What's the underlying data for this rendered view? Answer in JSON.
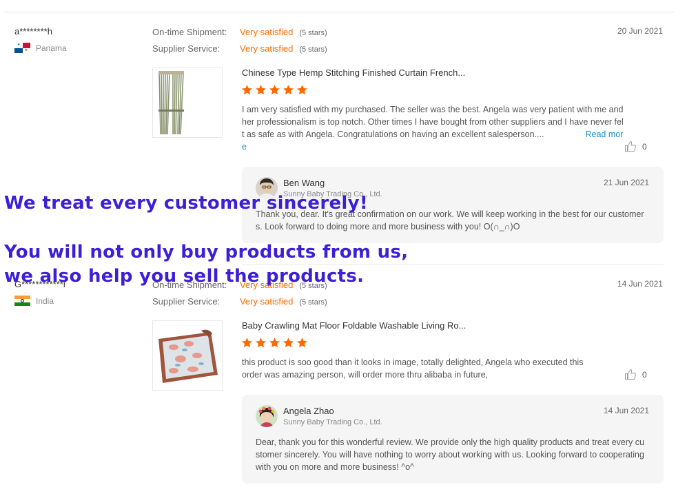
{
  "colors": {
    "accent": "#ff6a00",
    "link": "#1a8ed1",
    "overlay_text": "#3d1fd6",
    "reply_bg": "#f5f5f5"
  },
  "reviews": [
    {
      "buyer": "a********h",
      "country": "Panama",
      "flag_icon": "panama-flag-icon",
      "ontime_label": "On-time Shipment:",
      "ontime_value": "Very satisfied",
      "ontime_stars": "(5 stars)",
      "service_label": "Supplier Service:",
      "service_value": "Very satisfied",
      "service_stars": "(5 stars)",
      "date": "20 Jun 2021",
      "product_title": "Chinese Type Hemp Stitching Finished Curtain French...",
      "rating": 5,
      "text": "I am very satisfied with my purchased.  The seller was the best. Angela was very patient with me and her professionalism is top notch.  Other times I have bought from other suppliers and I have never felt as safe as with Angela. Congratulations on having an excellent salesperson....",
      "read_more": "Read more",
      "helpful_count": "0",
      "reply": {
        "name": "Ben Wang",
        "company": "Sunny Baby Trading Co., Ltd.",
        "date": "21 Jun 2021",
        "text": "Thank you, dear. It's great confirmation on our work. We will keep working in the best for our customers. Look forward to doing more and more business with you! O(∩_∩)O"
      }
    },
    {
      "buyer": "G************l",
      "country": "India",
      "flag_icon": "india-flag-icon",
      "ontime_label": "On-time Shipment:",
      "ontime_value": "Very satisfied",
      "ontime_stars": "(5 stars)",
      "service_label": "Supplier Service:",
      "service_value": "Very satisfied",
      "service_stars": "(5 stars)",
      "date": "14 Jun 2021",
      "product_title": "Baby Crawling Mat Floor Foldable Washable Living Ro...",
      "rating": 5,
      "text": "this product is soo good than it looks in image, totally delighted, Angela who executed this order was amazing person, will order more thru alibaba in future,",
      "helpful_count": "0",
      "reply": {
        "name": "Angela Zhao",
        "company": "Sunny Baby Trading Co., Ltd.",
        "date": "14 Jun 2021",
        "text": "Dear, thank you for this wonderful review. We provide only the high quality products and treat every customer sincerely. You will have nothing to worry about working with us. Looking forward to cooperating with you on more and more business! ^o^"
      }
    }
  ],
  "overlay": {
    "line1": "We treat every customer sincerely!",
    "line2": "You will not only buy products from us,",
    "line3": "we also help you sell the products."
  }
}
